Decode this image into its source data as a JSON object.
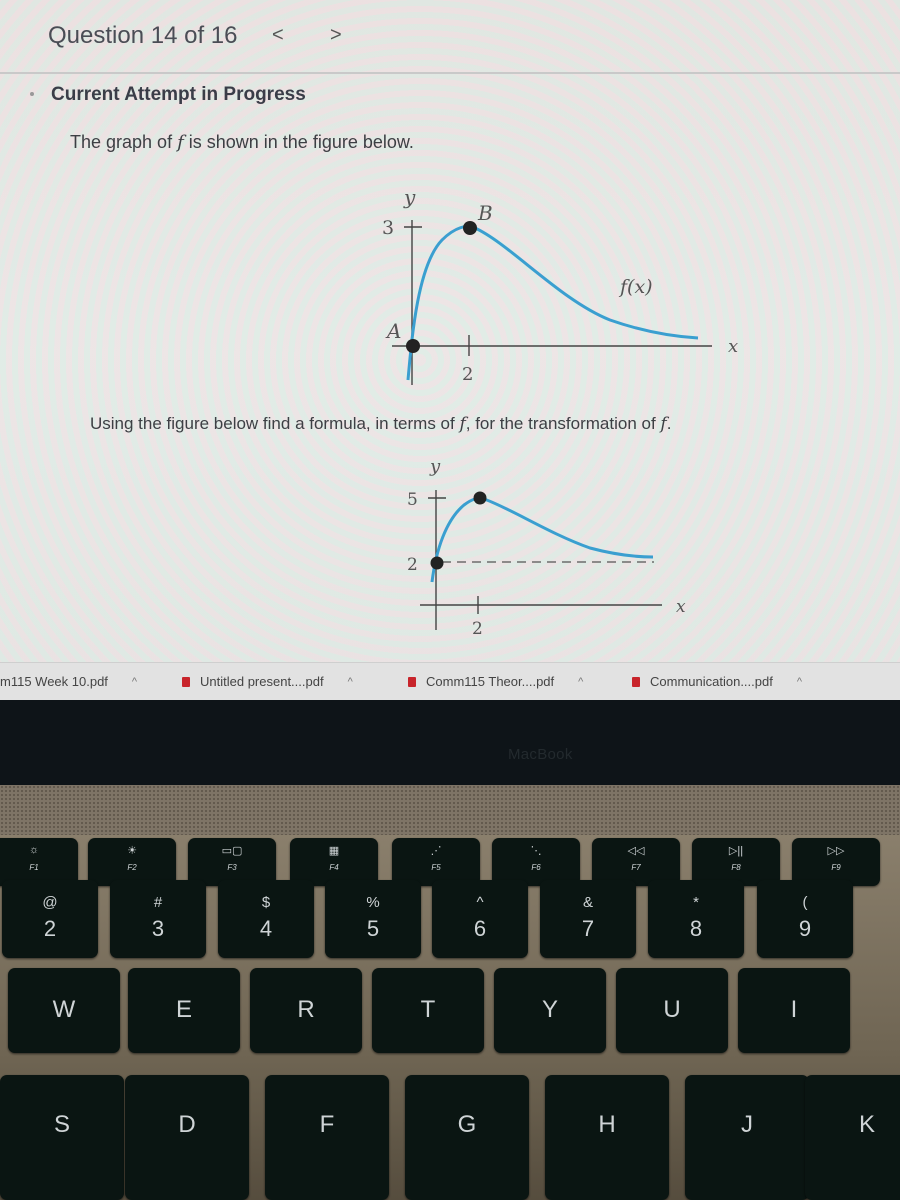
{
  "question": {
    "title": "Question 14 of 16",
    "prev_label": "<",
    "next_label": ">",
    "status": "Current Attempt in Progress",
    "text1_pre": "The graph of ",
    "text1_var": "f",
    "text1_post": " is shown in the figure below.",
    "text2_pre": "Using the figure below find a formula, in terms of ",
    "text2_var1": "f",
    "text2_mid": ", for the transformation of ",
    "text2_var2": "f",
    "text2_post": "."
  },
  "chart_data": [
    {
      "type": "line",
      "title": "Graph of f",
      "xlabel": "x",
      "ylabel": "y",
      "curve_label": "f(x)",
      "y_ticks": [
        "3"
      ],
      "x_ticks": [
        "2"
      ],
      "points": [
        {
          "label": "A",
          "x": 0,
          "y": 0
        },
        {
          "label": "B",
          "x": 2,
          "y": 3
        }
      ],
      "horizontal_asymptote": 0,
      "curve_color": "#3a9fd0"
    },
    {
      "type": "line",
      "title": "Transformation of f",
      "xlabel": "x",
      "ylabel": "y",
      "y_ticks": [
        "5",
        "2"
      ],
      "x_ticks": [
        "2"
      ],
      "points": [
        {
          "label": "",
          "x": 0,
          "y": 2
        },
        {
          "label": "",
          "x": 2,
          "y": 5
        }
      ],
      "horizontal_asymptote": 2,
      "asymptote_style": "dashed",
      "curve_color": "#3a9fd0"
    }
  ],
  "downloads": [
    {
      "name": "m115 Week 10.pdf"
    },
    {
      "name": "Untitled present....pdf"
    },
    {
      "name": "Comm115 Theor....pdf"
    },
    {
      "name": "Communication....pdf"
    }
  ],
  "laptop": {
    "brand": "MacBook",
    "fkeys": [
      {
        "icon": "☼",
        "label": "F1"
      },
      {
        "icon": "☀",
        "label": "F2"
      },
      {
        "icon": "▭▢",
        "label": "F3"
      },
      {
        "icon": "▦",
        "label": "F4"
      },
      {
        "icon": "⋰",
        "label": "F5"
      },
      {
        "icon": "⋱",
        "label": "F6"
      },
      {
        "icon": "◁◁",
        "label": "F7"
      },
      {
        "icon": "▷||",
        "label": "F8"
      },
      {
        "icon": "▷▷",
        "label": "F9"
      }
    ],
    "numkeys": [
      {
        "sym": "@",
        "num": "2"
      },
      {
        "sym": "#",
        "num": "3"
      },
      {
        "sym": "$",
        "num": "4"
      },
      {
        "sym": "%",
        "num": "5"
      },
      {
        "sym": "^",
        "num": "6"
      },
      {
        "sym": "&",
        "num": "7"
      },
      {
        "sym": "*",
        "num": "8"
      },
      {
        "sym": "(",
        "num": "9"
      }
    ],
    "row2": [
      "W",
      "E",
      "R",
      "T",
      "Y",
      "U",
      "I"
    ],
    "row3": [
      "S",
      "D",
      "F",
      "G",
      "H",
      "J",
      "K"
    ]
  }
}
